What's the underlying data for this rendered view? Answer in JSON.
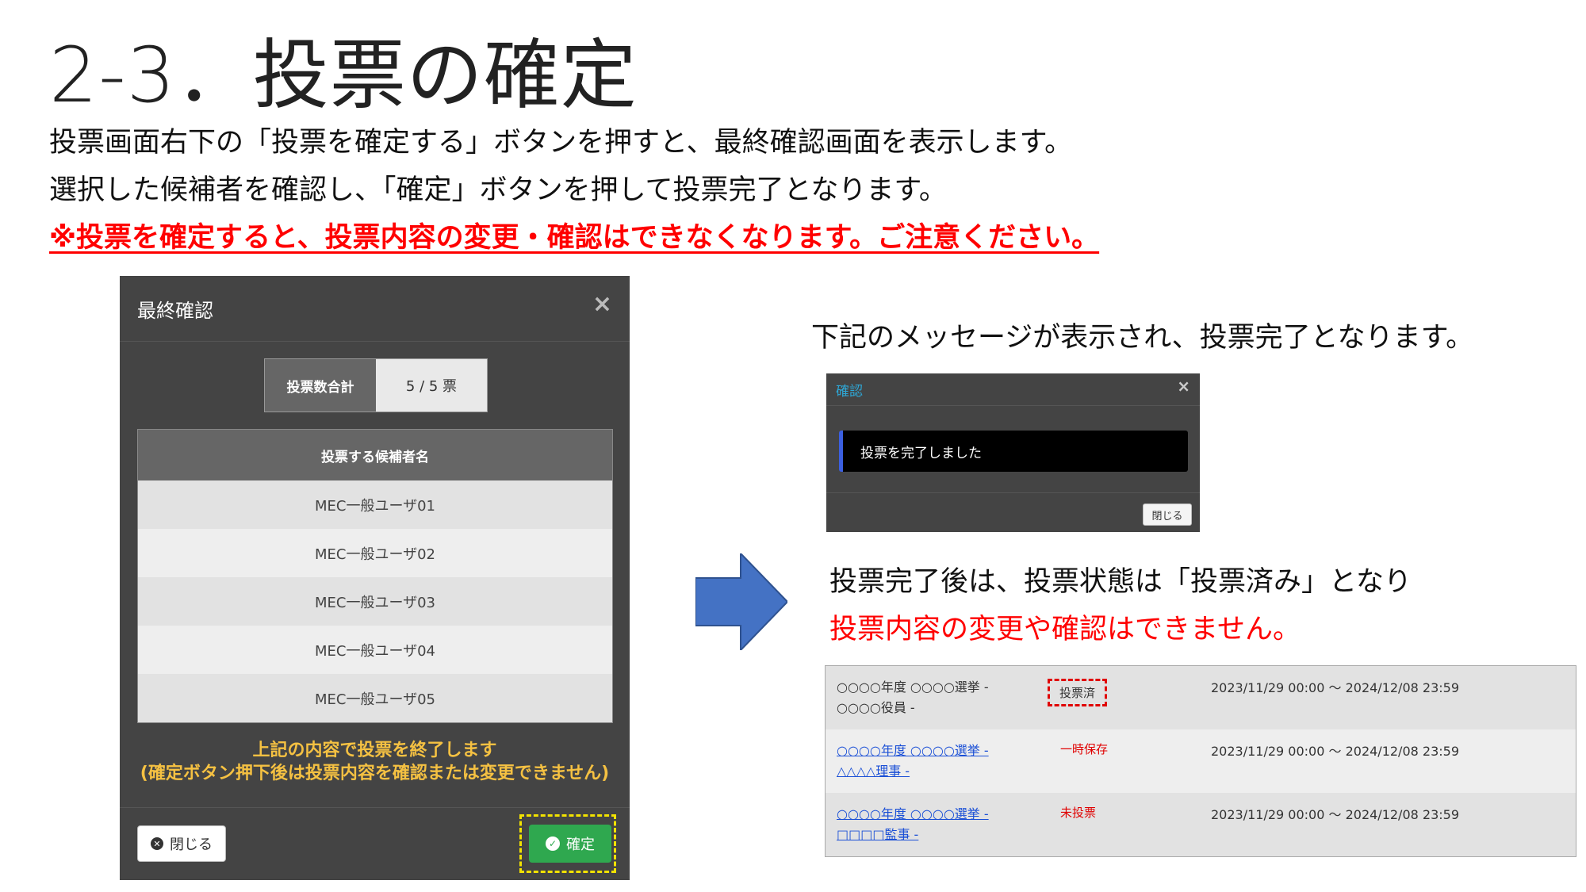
{
  "header": {
    "title": "2-3．投票の確定",
    "desc1": "投票画面右下の「投票を確定する」ボタンを押すと、最終確認画面を表示します。",
    "desc2": "選択した候補者を確認し、「確定」ボタンを押して投票完了となります。",
    "warning": "※投票を確定すると、投票内容の変更・確認はできなくなります。ご注意ください。"
  },
  "final_modal": {
    "title": "最終確認",
    "close_glyph": "×",
    "count_label": "投票数合計",
    "count_value": "5 / 5 票",
    "table_header": "投票する候補者名",
    "candidates": [
      "MEC一般ユーザ01",
      "MEC一般ユーザ02",
      "MEC一般ユーザ03",
      "MEC一般ユーザ04",
      "MEC一般ユーザ05"
    ],
    "message_line1": "上記の内容で投票を終了します",
    "message_line2": "(確定ボタン押下後は投票内容を確認または変更できません)",
    "close_button": "閉じる",
    "confirm_button": "確定",
    "close_icon": "circle-x-icon",
    "confirm_icon": "check-circle-icon"
  },
  "right": {
    "text1": "下記のメッセージが表示され、投票完了となります。",
    "text2": "投票完了後は、投票状態は「投票済み」となり",
    "text3": "投票内容の変更や確認はできません。"
  },
  "confirm_dialog": {
    "title": "確認",
    "close_glyph": "×",
    "message": "投票を完了しました",
    "close_button": "閉じる"
  },
  "status_table": {
    "rows": [
      {
        "name": "○○○○年度 ○○○○選挙 - ○○○○役員 -",
        "status": "投票済",
        "period": "2023/11/29 00:00 ～ 2024/12/08 23:59"
      },
      {
        "name": "○○○○年度 ○○○○選挙 - △△△△理事 -",
        "status": "一時保存",
        "period": "2023/11/29 00:00 ～ 2024/12/08 23:59"
      },
      {
        "name": "○○○○年度 ○○○○選挙 - □□□□監事 -",
        "status": "未投票",
        "period": "2023/11/29 00:00 ～ 2024/12/08 23:59"
      }
    ]
  },
  "colors": {
    "warning_red": "#ff0000",
    "modal_bg": "#444444",
    "confirm_green": "#2fa84f",
    "highlight_yellow": "#f2e200",
    "arrow_blue": "#4472c4"
  }
}
